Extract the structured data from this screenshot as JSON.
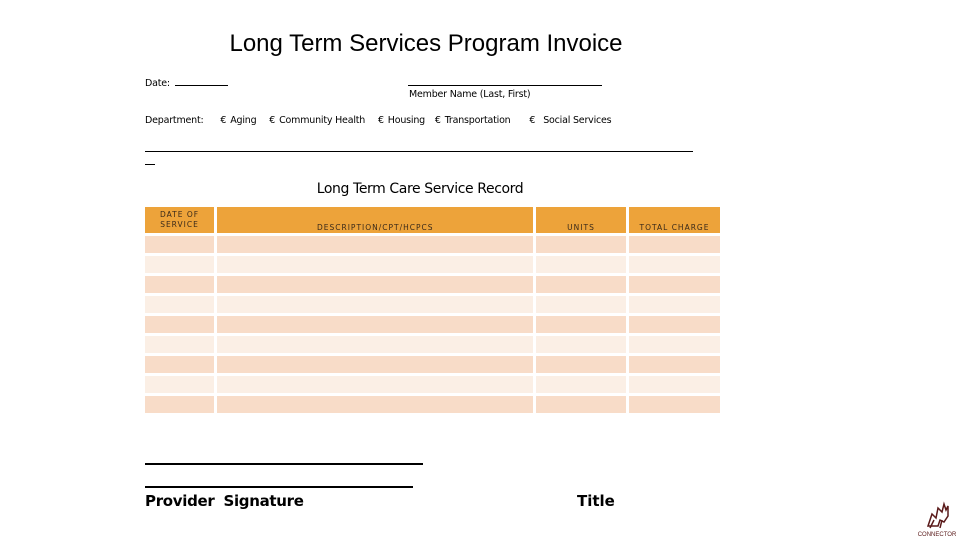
{
  "document": {
    "title": "Long Term Services Program Invoice"
  },
  "header_fields": {
    "date_label": "Date:",
    "member_name_label": "Member Name (Last, First)"
  },
  "department": {
    "label": "Department:",
    "checkbox_glyph": "€",
    "options": [
      "Aging",
      "Community Health",
      "Housing",
      "Transportation",
      "Social Services"
    ]
  },
  "record": {
    "title": "Long Term Care Service Record",
    "columns": [
      "DATE OF SERVICE",
      "DESCRIPTION/CPT/HCPCS",
      "UNITS",
      "TOTAL CHARGE"
    ],
    "rows": [
      [
        "",
        "",
        "",
        ""
      ],
      [
        "",
        "",
        "",
        ""
      ],
      [
        "",
        "",
        "",
        ""
      ],
      [
        "",
        "",
        "",
        ""
      ],
      [
        "",
        "",
        "",
        ""
      ],
      [
        "",
        "",
        "",
        ""
      ],
      [
        "",
        "",
        "",
        ""
      ],
      [
        "",
        "",
        "",
        ""
      ],
      [
        "",
        "",
        "",
        ""
      ]
    ],
    "colors": {
      "header": "#eda33a",
      "row_dark": "#f8dcc8",
      "row_light": "#fbefe5"
    }
  },
  "footer": {
    "provider_signature_label": "Provider Signature",
    "title_label": "Title"
  },
  "logo": {
    "icon": "wolf-logo-icon",
    "caption": "CONNECTOR"
  }
}
